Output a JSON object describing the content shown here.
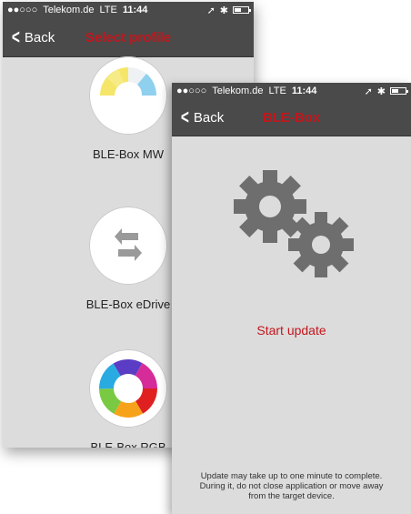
{
  "back_screen": {
    "status": {
      "signal": "●●○○○",
      "carrier": "Telekom.de",
      "network": "LTE",
      "time": "11:44"
    },
    "nav": {
      "back_label": "Back",
      "title": "Select profile"
    },
    "profiles": [
      {
        "label": "BLE-Box MW",
        "icon": "mw-color-ring-icon"
      },
      {
        "label": "BLE-Box eDrive",
        "icon": "swap-arrows-icon"
      },
      {
        "label": "BLE-Box RGB",
        "icon": "rgb-color-wheel-icon"
      }
    ]
  },
  "front_screen": {
    "status": {
      "signal": "●●○○○",
      "carrier": "Telekom.de",
      "network": "LTE",
      "time": "11:44"
    },
    "nav": {
      "back_label": "Back",
      "title": "BLE-Box"
    },
    "icon": "gears-icon",
    "start_update": "Start update",
    "note_lines": [
      "Update may take up to one minute to complete.",
      "During it, do not close application or move away",
      "from the target device."
    ]
  },
  "colors": {
    "accent": "#c4161c",
    "bar": "#4a4a4a",
    "background": "#dcdcdc",
    "gear": "#6e6e6e"
  }
}
